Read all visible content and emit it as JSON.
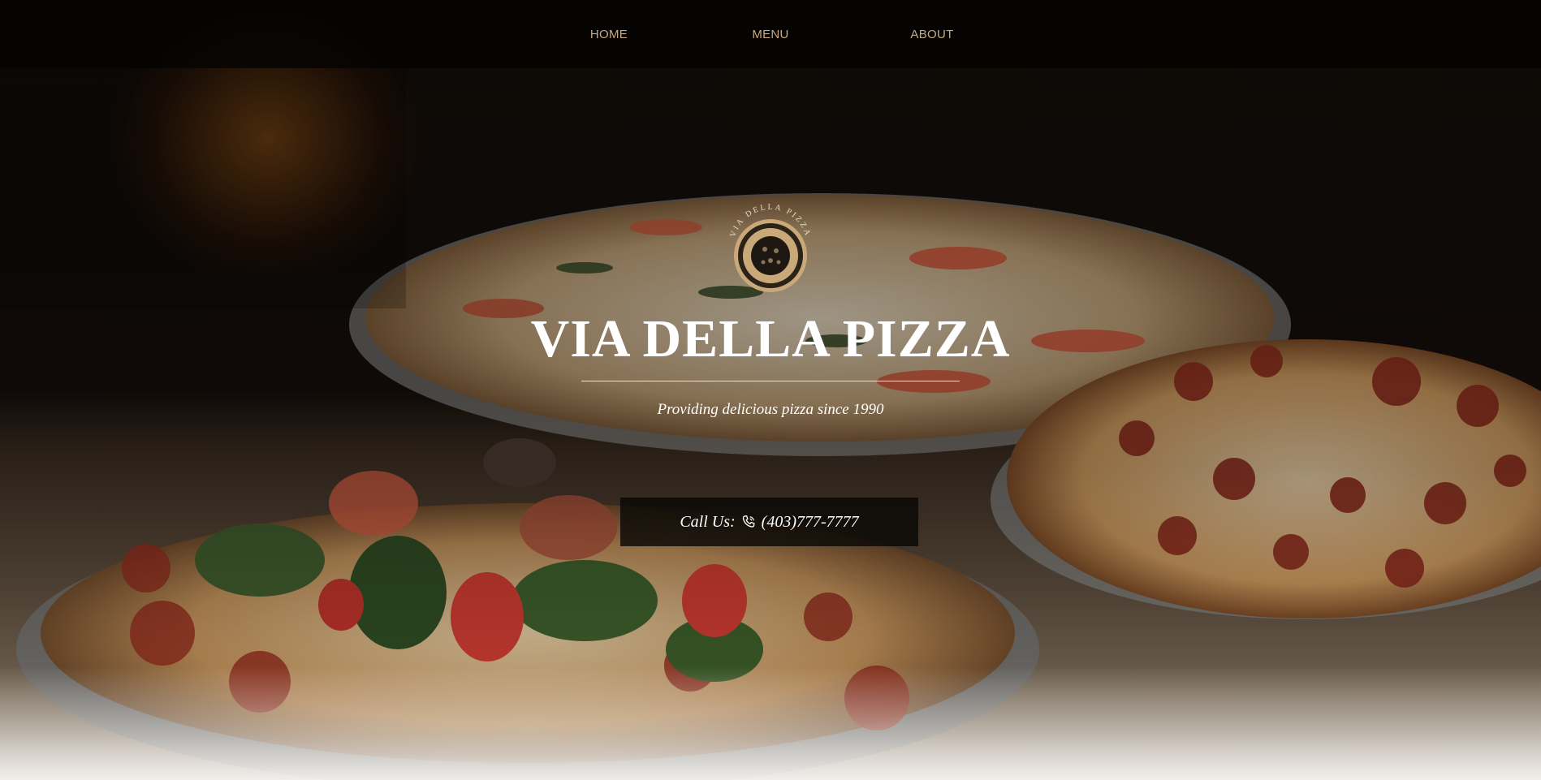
{
  "nav": {
    "items": [
      {
        "label": "HOME"
      },
      {
        "label": "MENU"
      },
      {
        "label": "ABOUT"
      }
    ]
  },
  "logo": {
    "arc_text": "VIA DELLA PIZZA",
    "icon": "pizza-logo-icon"
  },
  "hero": {
    "title": "VIA DELLA PIZZA",
    "tagline": "Providing delicious pizza since 1990",
    "background": "pizzas-on-stands-photo"
  },
  "call": {
    "label": "Call Us:",
    "phone_icon": "phone-icon",
    "number": "(403)777-7777"
  },
  "colors": {
    "nav_text": "#c8a97e",
    "title": "#ffffff",
    "logo_gold": "#c9a97a"
  }
}
